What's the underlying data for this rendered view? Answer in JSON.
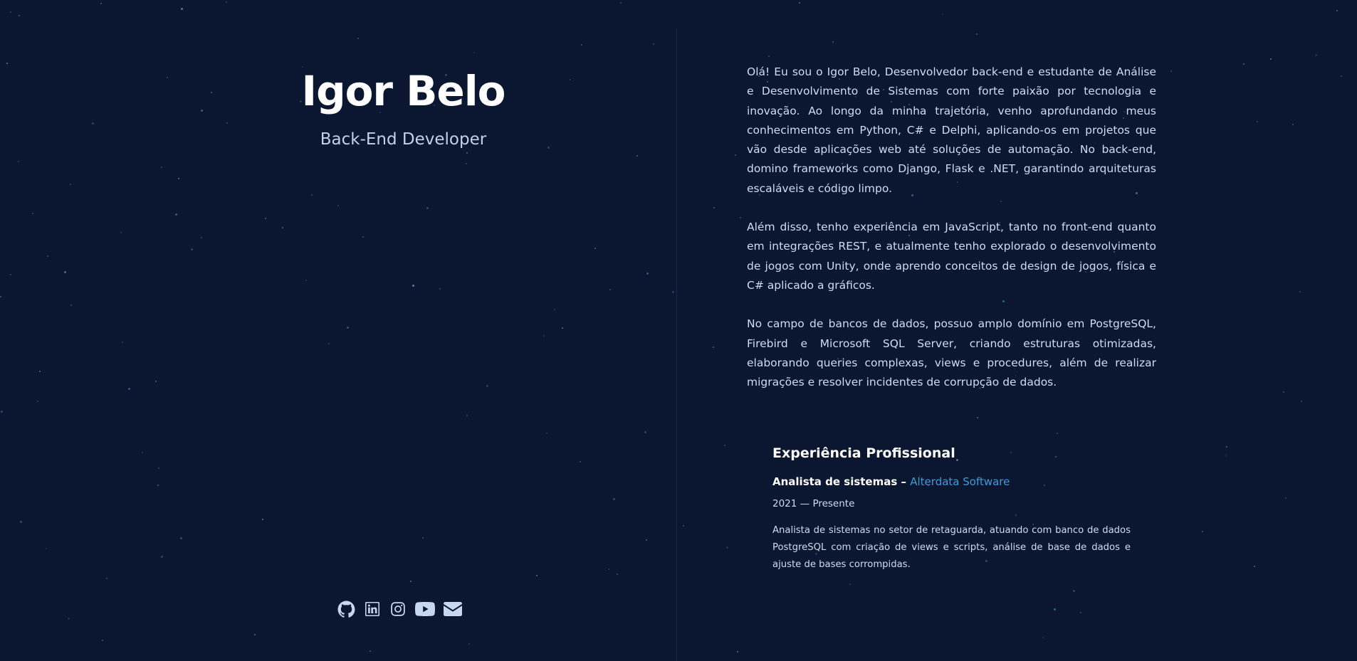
{
  "profile": {
    "name": "Igor Belo",
    "role": "Back-End Developer"
  },
  "socials": [
    {
      "name": "github",
      "icon": "github-icon"
    },
    {
      "name": "linkedin",
      "icon": "linkedin-icon"
    },
    {
      "name": "instagram",
      "icon": "instagram-icon"
    },
    {
      "name": "youtube",
      "icon": "youtube-icon"
    },
    {
      "name": "email",
      "icon": "envelope-icon"
    }
  ],
  "about": {
    "paragraphs": [
      "Olá! Eu sou o Igor Belo, Desenvolvedor back-end e estudante de Análise e Desenvolvimento de Sistemas com forte paixão por tecnologia e inovação. Ao longo da minha trajetória, venho aprofundando meus conhecimentos em Python, C# e Delphi, aplicando-os em projetos que vão desde aplicações web até soluções de automação. No back-end, domino frameworks como Django, Flask e .NET, garantindo arquiteturas escaláveis e código limpo.",
      "Além disso, tenho experiência em JavaScript, tanto no front-end quanto em integrações REST, e atualmente tenho explorado o desenvolvimento de jogos com Unity, onde aprendo conceitos de design de jogos, física e C# aplicado a gráficos.",
      "No campo de bancos de dados, possuo amplo domínio em PostgreSQL, Firebird e Microsoft SQL Server, criando estruturas otimizadas, elaborando queries complexas, views e procedures, além de realizar migrações e resolver incidentes de corrupção de dados."
    ]
  },
  "experience": {
    "title": "Experiência Profissional",
    "jobs": [
      {
        "position": "Analista de sistemas –",
        "company": "Alterdata Software",
        "dates": "2021 — Presente",
        "description": "Analista de sistemas no setor de retaguarda, atuando com banco de dados PostgreSQL com criação de views e scripts, análise de base de dados e ajuste de bases corrompidas."
      }
    ]
  },
  "colors": {
    "background": "#0b1730",
    "accent": "#3d9bd9",
    "text": "#cfdbef",
    "heading": "#ffffff"
  }
}
